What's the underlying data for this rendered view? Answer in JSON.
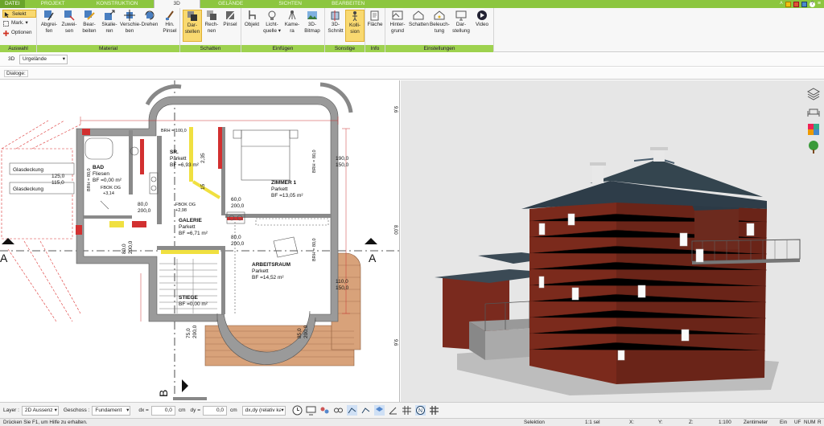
{
  "menu": {
    "tabs": [
      "DATEI",
      "PROJEKT",
      "KONSTRUKTION",
      "3D",
      "GELÄNDE",
      "SICHTEN",
      "BEARBEITEN"
    ]
  },
  "ribbon": {
    "auswahl": {
      "label": "Auswahl",
      "select": "Selekt",
      "mark": "Mark.",
      "optionen": "Optionen"
    },
    "material": {
      "label": "Material",
      "buttons": [
        "Abgrei-\nfen",
        "Zuwei-\nsen",
        "Bear-\nbeiten",
        "Skalie-\nren",
        "Verschie-\nben",
        "Drehen",
        "Hin.\nPinsel"
      ]
    },
    "schatten": {
      "label": "Schatten",
      "buttons": [
        "Dar-\nstellen",
        "Rech-\nnen",
        "Pinsel"
      ]
    },
    "einfuegen": {
      "label": "Einfügen",
      "buttons": [
        "Objekt",
        "Licht-\nquelle ▾",
        "Kame-\nra",
        "3D-\nBitmap"
      ]
    },
    "sonstige": {
      "label": "Sonstige",
      "buttons": [
        "3D-\nSchnitt",
        "Kolli-\nsion"
      ]
    },
    "info": {
      "label": "Info",
      "buttons": [
        "Fläche"
      ]
    },
    "einstellungen": {
      "label": "Einstellungen",
      "buttons": [
        "Hinter-\ngrund",
        "Schatten",
        "Beleuch-\ntung",
        "Dar-\nstellung",
        "Video"
      ]
    }
  },
  "toolbar2": {
    "mode": "3D",
    "layer_select": "Urgelände"
  },
  "toolbar3": {
    "label": "Dialoge:"
  },
  "plan": {
    "rooms": [
      {
        "name": "BAD",
        "line1": "Fliesen",
        "line2": "BF =0,00 m²"
      },
      {
        "name": "ZIMMER 1",
        "line1": "Parkett",
        "line2": "BF =13,05 m²"
      },
      {
        "name": "SR.",
        "line1": "Parkett",
        "line2": "BF =6,93 m²"
      },
      {
        "name": "GALERIE",
        "line1": "Parkett",
        "line2": "BF =6,71 m²"
      },
      {
        "name": "ARBEITSRAUM",
        "line1": "Parkett",
        "line2": "BF =14,52 m²"
      },
      {
        "name": "STIEGE",
        "line1": "BF =0,00 m²",
        "line2": ""
      }
    ],
    "glasdeckung": [
      "Glasdeckung",
      "Glasdeckung"
    ],
    "dims": [
      "125,0",
      "115,0",
      "80,0",
      "200,0",
      "60,0",
      "200,0",
      "80,0",
      "200,0",
      "190,0",
      "150,0",
      "110,0",
      "150,0",
      "75,0",
      "200,0",
      "85,0",
      "200,0",
      "2,35",
      "15",
      "80,0",
      "200,0"
    ],
    "fbok": [
      "FBOK OG",
      "+3,14",
      "FBOK OG",
      "+2,98"
    ],
    "brh": [
      "BRH = 100,0",
      "BRH = 80,0",
      "BRH = 80,0",
      "BRH = 80,0"
    ],
    "section_a": "A",
    "section_b": "B",
    "side_nums": [
      "9,6",
      "8,00",
      "9,6"
    ]
  },
  "bottom": {
    "layer_label": "Layer :",
    "layer_value": "2D Aussenz",
    "geschoss_label": "Geschoss :",
    "geschoss_value": "Fundament",
    "dx_label": "dx =",
    "dx_value": "0,0",
    "dx_unit": "cm",
    "dy_label": "dy =",
    "dy_value": "0,0",
    "dy_unit": "cm",
    "mode_value": "dx,dy (relativ ka"
  },
  "status": {
    "help": "Drücken Sie F1, um Hilfe zu erhalten.",
    "mode": "Selektion",
    "sel": "1:1 sel",
    "x": "X:",
    "y": "Y:",
    "z": "Z:",
    "scale": "1:100",
    "unit": "Zentimeter",
    "flags": [
      "Ein",
      "UF",
      "NUM",
      "R"
    ]
  },
  "colors": {
    "menu": "#8cc63f",
    "group_label": "#9ed24f",
    "wall_red": "#d23030",
    "wall_yellow": "#f0e040"
  }
}
